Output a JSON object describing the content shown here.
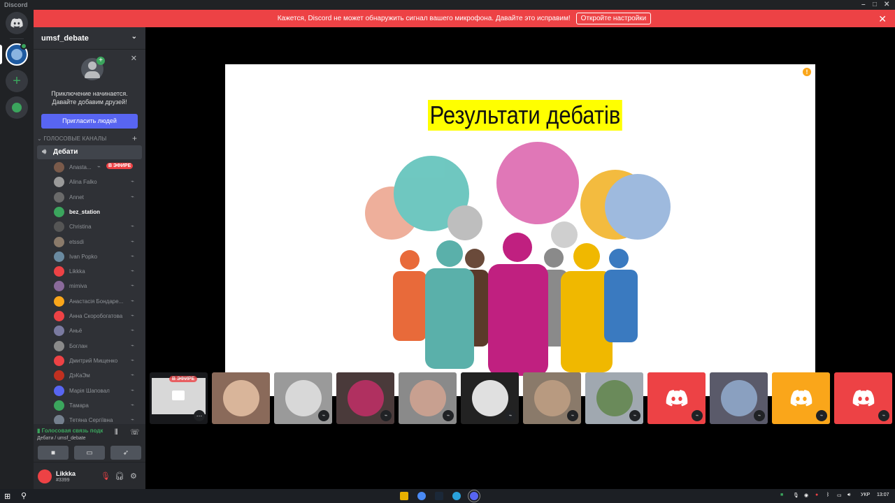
{
  "window": {
    "title": "Discord"
  },
  "banner": {
    "message": "Кажется, Discord не может обнаружить сигнал вашего микрофона. Давайте это исправим!",
    "button": "Откройте настройки"
  },
  "server": {
    "name": "umsf_debate"
  },
  "invite": {
    "line1": "Приключение начинается.",
    "line2": "Давайте добавим друзей!",
    "button": "Пригласить людей"
  },
  "category": "ГОЛОСОВЫЕ КАНАЛЫ",
  "channel": "Дебати",
  "live_badge": "В ЭФИРЕ",
  "members": [
    {
      "name": "Anastа...",
      "color": "#7a5a4a",
      "live": true
    },
    {
      "name": "Alina Falko",
      "color": "#9a9a9a"
    },
    {
      "name": "Annet",
      "color": "#6a6a6a"
    },
    {
      "name": "bez_station",
      "color": "#3ba55d",
      "bold": true
    },
    {
      "name": "Christina",
      "color": "#555"
    },
    {
      "name": "etssdi",
      "color": "#8a7a6a"
    },
    {
      "name": "Ivan Popko",
      "color": "#6a8aa0"
    },
    {
      "name": "Likkka",
      "color": "#ed4245"
    },
    {
      "name": "mimiva",
      "color": "#8a6a9a"
    },
    {
      "name": "Анастасія Бондаре...",
      "color": "#faa61a"
    },
    {
      "name": "Анна Скоробогатова",
      "color": "#ed4245"
    },
    {
      "name": "Аньё",
      "color": "#7a7aa0"
    },
    {
      "name": "Боглан",
      "color": "#8a8a8a"
    },
    {
      "name": "Дмитрий Мищенко",
      "color": "#ed4245"
    },
    {
      "name": "ДэКаЭм",
      "color": "#c03020"
    },
    {
      "name": "Марія Шаповал",
      "color": "#5865f2"
    },
    {
      "name": "Тамара",
      "color": "#3ba55d"
    },
    {
      "name": "Тетяна Сергіївна",
      "color": "#747f8d"
    }
  ],
  "voice": {
    "status": "Голосовая связь подк",
    "location": "Дебати / umsf_debate"
  },
  "user": {
    "name": "Likkka",
    "tag": "#3399"
  },
  "slide": {
    "title": "Результати дебатів"
  },
  "tiles": [
    {
      "kind": "stream",
      "live": "В ЭФИРЕ"
    },
    {
      "kind": "photo",
      "bg": "#8a6a5a",
      "ph": "#d9b59a"
    },
    {
      "kind": "photo",
      "bg": "#9a9a9a",
      "ph": "#d8d8d8"
    },
    {
      "kind": "photo",
      "bg": "#4a3a3a",
      "ph": "#b03060"
    },
    {
      "kind": "photo",
      "bg": "#8a8a8a",
      "ph": "#c8a090"
    },
    {
      "kind": "photo",
      "bg": "#222",
      "ph": "#e0e0e0"
    },
    {
      "kind": "photo",
      "bg": "#8a7a6a",
      "ph": "#b89a80"
    },
    {
      "kind": "photo",
      "bg": "#a0a8b0",
      "ph": "#6a8a5a"
    },
    {
      "kind": "discord",
      "bg": "#ed4245"
    },
    {
      "kind": "photo",
      "bg": "#5a5a6a",
      "ph": "#8aa0c0"
    },
    {
      "kind": "discord",
      "bg": "#faa61a"
    },
    {
      "kind": "discord",
      "bg": "#ed4245"
    }
  ],
  "taskbar": {
    "lang": "УКР",
    "time": "13:07"
  }
}
